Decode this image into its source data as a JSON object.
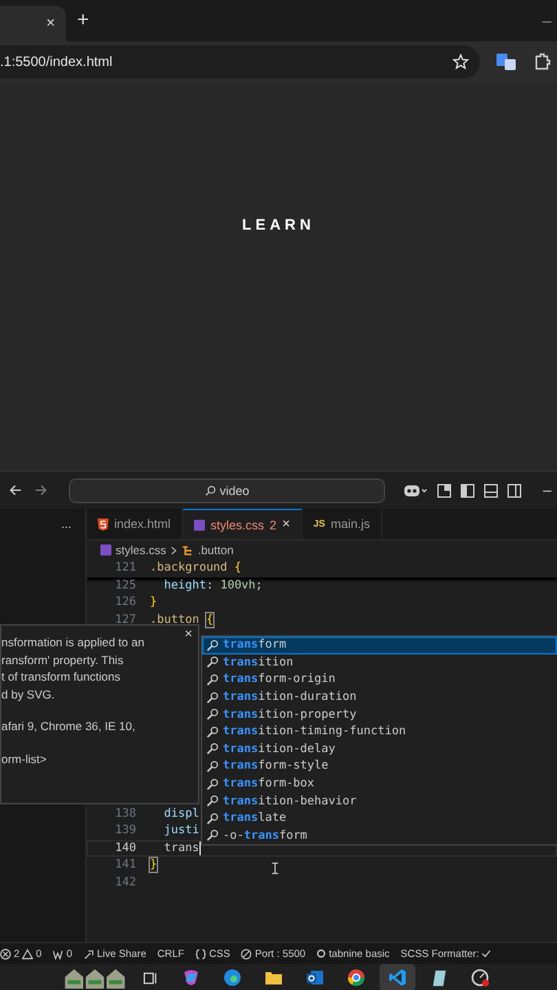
{
  "browser": {
    "tab_close": "×",
    "new_tab": "+",
    "minimize": "–",
    "url": ".1:5500/index.html"
  },
  "page": {
    "heading": "LEARN"
  },
  "editor_title": {
    "search": "video"
  },
  "explorer": {
    "more": "..."
  },
  "editor_tabs": [
    {
      "label": "index.html",
      "kind": "html",
      "selected": false
    },
    {
      "label": "styles.css",
      "kind": "css",
      "selected": true,
      "problems": "2",
      "close": "×"
    },
    {
      "label": "main.js",
      "kind": "js",
      "icon_label": "JS",
      "selected": false
    }
  ],
  "breadcrumb": {
    "file": "styles.css",
    "symbol": ".button"
  },
  "code_top": [
    {
      "number": "121",
      "tokens": [
        {
          "text": ".background ",
          "kind": "selector"
        },
        {
          "text": "{",
          "kind": "brace"
        }
      ]
    },
    {
      "number": "125",
      "tokens": [
        {
          "text": "  height",
          "kind": "property"
        },
        {
          "text": ": ",
          "kind": "plain"
        },
        {
          "text": "100vh",
          "kind": "value"
        },
        {
          "text": ";",
          "kind": "plain"
        }
      ]
    },
    {
      "number": "126",
      "tokens": [
        {
          "text": "}",
          "kind": "brace"
        }
      ]
    },
    {
      "number": "127",
      "tokens": [
        {
          "text": ".button ",
          "kind": "selector"
        },
        {
          "text": "{",
          "kind": "brace-match"
        }
      ]
    }
  ],
  "code_bottom": [
    {
      "number": "138",
      "current": false,
      "tokens": [
        {
          "text": "  displ",
          "kind": "property"
        }
      ]
    },
    {
      "number": "139",
      "current": false,
      "tokens": [
        {
          "text": "  justi",
          "kind": "property"
        }
      ]
    },
    {
      "number": "140",
      "current": true,
      "tokens": [
        {
          "text": "  trans",
          "kind": "plain"
        }
      ]
    },
    {
      "number": "141",
      "current": false,
      "tokens": [
        {
          "text": "}",
          "kind": "brace-match"
        }
      ]
    },
    {
      "number": "142",
      "current": false
    }
  ],
  "hover_doc": {
    "close": "×",
    "paragraphs": [
      [
        "nsformation is applied to an",
        "ransform' property. This",
        "t of transform functions",
        "d by SVG."
      ],
      [
        "afari 9, Chrome 36, IE 10,"
      ],
      [
        "orm-list>"
      ]
    ]
  },
  "suggestions": [
    {
      "match": "trans",
      "after": "form",
      "selected": true
    },
    {
      "match": "trans",
      "after": "ition",
      "selected": false
    },
    {
      "match": "trans",
      "after": "form-origin",
      "selected": false
    },
    {
      "match": "trans",
      "after": "ition-duration",
      "selected": false
    },
    {
      "match": "trans",
      "after": "ition-property",
      "selected": false
    },
    {
      "match": "trans",
      "after": "ition-timing-function",
      "selected": false
    },
    {
      "match": "trans",
      "after": "ition-delay",
      "selected": false
    },
    {
      "match": "trans",
      "after": "form-style",
      "selected": false
    },
    {
      "match": "trans",
      "after": "form-box",
      "selected": false
    },
    {
      "match": "trans",
      "after": "ition-behavior",
      "selected": false
    },
    {
      "match": "trans",
      "after": "late",
      "selected": false
    },
    {
      "before": "-o-",
      "match": "trans",
      "after": "form",
      "selected": false
    }
  ],
  "status_bar": {
    "errors": "2",
    "warnings": "0",
    "ports_forwarded": "0",
    "live_share": "Live Share",
    "eol": "CRLF",
    "language": "CSS",
    "port": "Port : 5500",
    "tabnine": "tabnine basic",
    "formatter": "SCSS Formatter:"
  },
  "taskbar": {
    "items": [
      {
        "selected": false
      },
      {
        "selected": false
      },
      {
        "selected": false
      },
      {
        "selected": false
      },
      {
        "selected": false
      },
      {
        "selected": false
      },
      {
        "selected": false
      },
      {
        "selected": true
      },
      {
        "selected": false
      },
      {
        "selected": false
      }
    ]
  }
}
